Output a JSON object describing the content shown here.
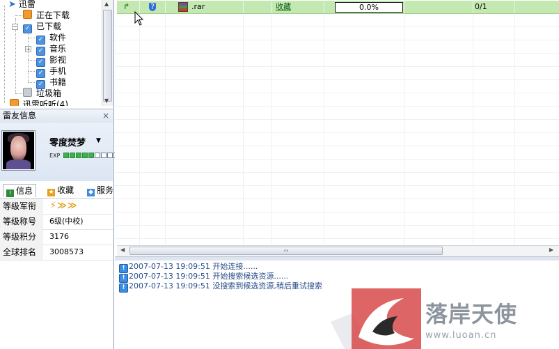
{
  "tree": {
    "root": "迅雷",
    "items": [
      {
        "label": "正在下载",
        "icon": "downloading-folder-icon"
      },
      {
        "label": "已下载",
        "icon": "downloaded-folder-icon"
      },
      {
        "label": "软件",
        "icon": "category-icon"
      },
      {
        "label": "音乐",
        "icon": "category-icon"
      },
      {
        "label": "影视",
        "icon": "category-icon"
      },
      {
        "label": "手机",
        "icon": "category-icon"
      },
      {
        "label": "书籍",
        "icon": "category-icon"
      },
      {
        "label": "垃圾箱",
        "icon": "trash-icon"
      },
      {
        "label": "迅雷听听(4)",
        "icon": "music-folder-icon"
      }
    ]
  },
  "friend_info": {
    "title": "雷友信息",
    "close": "×",
    "username": "零度焚梦",
    "exp_label": "EXP",
    "exp_level": 0.5,
    "tabs": [
      {
        "label": "信息",
        "icon": "info-icon"
      },
      {
        "label": "收藏",
        "icon": "star-icon"
      },
      {
        "label": "服务",
        "icon": "service-icon"
      }
    ],
    "rows": [
      {
        "key": "等级军衔",
        "value": ""
      },
      {
        "key": "等级称号",
        "value": "6级(中校)"
      },
      {
        "key": "等级积分",
        "value": "3176"
      },
      {
        "key": "全球排名",
        "value": "3008573"
      }
    ]
  },
  "task": {
    "filename": ".rar",
    "collect": "收藏",
    "progress": "0.0%",
    "ratio": "0/1"
  },
  "log": [
    {
      "time": "2007-07-13 19:09:51",
      "msg": "开始连接......"
    },
    {
      "time": "2007-07-13 19:09:51",
      "msg": "开始搜索候选资源......"
    },
    {
      "time": "2007-07-13 19:09:51",
      "msg": "没搜索到候选资源,稍后重试搜索"
    }
  ],
  "watermark": {
    "text": "落岸天使",
    "url": "www.luoan.cn"
  },
  "colors": {
    "selected_row": "#c4e8b2",
    "log_text": "#2a4d8a",
    "exp_on": "#3db24b"
  }
}
